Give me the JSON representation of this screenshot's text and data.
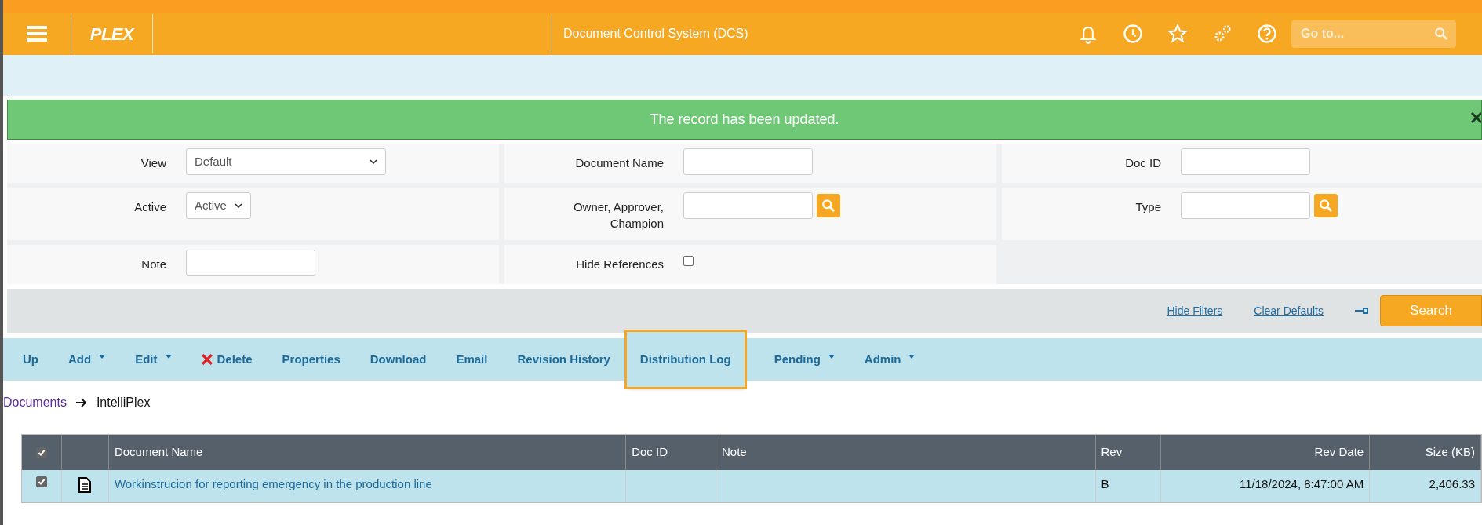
{
  "header": {
    "logo": "PLEX",
    "title": "Document Control System (DCS)",
    "goto": {
      "placeholder": "Go to..."
    }
  },
  "notification": {
    "message": "The record has been updated."
  },
  "filters": [
    {
      "label": "View",
      "kind": "wide-select",
      "value": "Default"
    },
    {
      "label": "Document Name",
      "kind": "text"
    },
    {
      "label": "Doc ID",
      "kind": "text"
    },
    {
      "label": "Active",
      "kind": "select",
      "value": "Active"
    },
    {
      "label": "Owner, Approver, Champion",
      "kind": "lookup"
    },
    {
      "label": "Type",
      "kind": "lookup"
    },
    {
      "label": "Note",
      "kind": "text"
    },
    {
      "label": "Hide References",
      "kind": "checkbox",
      "checked": false
    }
  ],
  "filter_actions": {
    "links": [
      "Hide Filters",
      "Clear Defaults"
    ],
    "search_button": "Search"
  },
  "toolbar": [
    {
      "label": "Up",
      "dropdown": false,
      "kind": "plain",
      "highlighted": false
    },
    {
      "label": "Add",
      "dropdown": true,
      "kind": "plain",
      "highlighted": false
    },
    {
      "label": "Edit",
      "dropdown": true,
      "kind": "plain",
      "highlighted": false
    },
    {
      "label": "Delete",
      "dropdown": false,
      "kind": "delete",
      "highlighted": false
    },
    {
      "label": "Properties",
      "dropdown": false,
      "kind": "plain",
      "highlighted": false
    },
    {
      "label": "Download",
      "dropdown": false,
      "kind": "plain",
      "highlighted": false
    },
    {
      "label": "Email",
      "dropdown": false,
      "kind": "plain",
      "highlighted": false
    },
    {
      "label": "Revision History",
      "dropdown": false,
      "kind": "plain",
      "highlighted": false
    },
    {
      "label": "Distribution Log",
      "dropdown": false,
      "kind": "plain",
      "highlighted": true
    },
    {
      "label": "Pending",
      "dropdown": true,
      "kind": "plain",
      "highlighted": false
    },
    {
      "label": "Admin",
      "dropdown": true,
      "kind": "plain",
      "highlighted": false
    }
  ],
  "breadcrumb": [
    {
      "label": "Documents",
      "link": true
    },
    {
      "label": "IntelliPlex",
      "link": false
    }
  ],
  "table": {
    "select_all": {
      "checked": true
    },
    "columns": [
      "Document Name",
      "Doc ID",
      "Note",
      "Rev",
      "Rev Date",
      "Size (KB)"
    ],
    "rows": [
      {
        "checked": true,
        "selected": true,
        "cells": [
          "Workinstrucion for reporting emergency in the production line",
          "",
          "",
          "B",
          "11/18/2024, 8:47:00 AM",
          "2,406.33"
        ]
      }
    ]
  }
}
